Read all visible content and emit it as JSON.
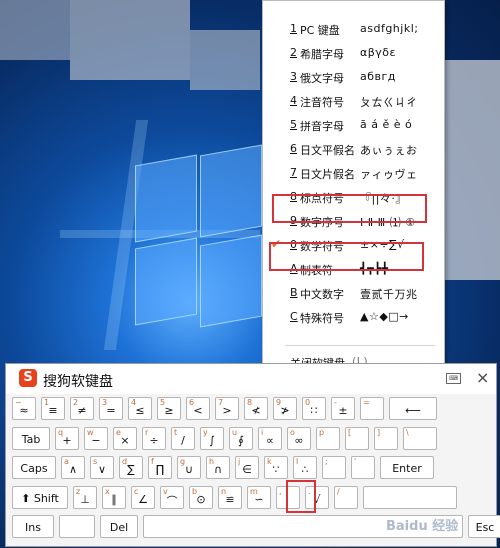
{
  "menu": {
    "items": [
      {
        "num": "1",
        "label": "PC 键盘",
        "sample": "asdfghjkl;",
        "checked": false
      },
      {
        "num": "2",
        "label": "希腊字母",
        "sample": "αβγδε",
        "checked": false
      },
      {
        "num": "3",
        "label": "俄文字母",
        "sample": "абвгд",
        "checked": false
      },
      {
        "num": "4",
        "label": "注音符号",
        "sample": "ㄆㄊㄍㄐㄔ",
        "checked": false
      },
      {
        "num": "5",
        "label": "拼音字母",
        "sample": "ā á ě è ó",
        "checked": false
      },
      {
        "num": "6",
        "label": "日文平假名",
        "sample": "あぃぅぇお",
        "checked": false
      },
      {
        "num": "7",
        "label": "日文片假名",
        "sample": "ァィゥヴェ",
        "checked": false
      },
      {
        "num": "8",
        "label": "标点符号",
        "sample": "『||々·』",
        "checked": false
      },
      {
        "num": "9",
        "label": "数字序号",
        "sample": "Ⅰ Ⅱ Ⅲ ⑴ ①",
        "checked": false
      },
      {
        "num": "0",
        "label": "数学符号",
        "sample": "±×÷∑√",
        "checked": true
      },
      {
        "num": "A",
        "label": "制表符",
        "sample": "┫┳┣╋",
        "checked": false
      },
      {
        "num": "B",
        "label": "中文数字",
        "sample": "壹贰千万兆",
        "checked": false
      },
      {
        "num": "C",
        "label": "特殊符号",
        "sample": "▲☆◆□→",
        "checked": false
      }
    ],
    "close_label": "关闭软键盘",
    "close_shortcut": "(L)"
  },
  "keyboard": {
    "title": "搜狗软键盘",
    "logo": "S",
    "close": "×",
    "rows": [
      [
        {
          "s": "~",
          "m": "≈",
          "w": 26
        },
        {
          "s": "1",
          "m": "≡",
          "w": 26
        },
        {
          "s": "2",
          "m": "≠",
          "w": 26
        },
        {
          "s": "3",
          "m": "=",
          "w": 26
        },
        {
          "s": "4",
          "m": "≤",
          "w": 26
        },
        {
          "s": "5",
          "m": "≥",
          "w": 26
        },
        {
          "s": "6",
          "m": "<",
          "w": 26
        },
        {
          "s": "7",
          "m": ">",
          "w": 26
        },
        {
          "s": "8",
          "m": "≮",
          "w": 26
        },
        {
          "s": "9",
          "m": "≯",
          "w": 26
        },
        {
          "s": "0",
          "m": "∷",
          "w": 26
        },
        {
          "s": "-",
          "m": "±",
          "w": 26
        },
        {
          "s": "=",
          "m": "",
          "w": 26
        },
        {
          "s": "",
          "m": "⟵",
          "w": 50
        }
      ],
      [
        {
          "s": "",
          "m": "Tab",
          "w": 40,
          "f": true
        },
        {
          "s": "q",
          "m": "+",
          "w": 26
        },
        {
          "s": "w",
          "m": "−",
          "w": 26
        },
        {
          "s": "e",
          "m": "×",
          "w": 26
        },
        {
          "s": "r",
          "m": "÷",
          "w": 26
        },
        {
          "s": "t",
          "m": "/",
          "w": 26
        },
        {
          "s": "y",
          "m": "∫",
          "w": 26
        },
        {
          "s": "u",
          "m": "∮",
          "w": 26
        },
        {
          "s": "i",
          "m": "∝",
          "w": 26
        },
        {
          "s": "o",
          "m": "∞",
          "w": 26
        },
        {
          "s": "p",
          "m": "",
          "w": 26
        },
        {
          "s": "[",
          "m": "",
          "w": 26
        },
        {
          "s": "]",
          "m": "",
          "w": 26
        },
        {
          "s": "\\",
          "m": "",
          "w": 36
        }
      ],
      [
        {
          "s": "",
          "m": "Caps",
          "w": 46,
          "f": true
        },
        {
          "s": "a",
          "m": "∧",
          "w": 26
        },
        {
          "s": "s",
          "m": "∨",
          "w": 26
        },
        {
          "s": "d",
          "m": "∑",
          "w": 26
        },
        {
          "s": "f",
          "m": "∏",
          "w": 26
        },
        {
          "s": "g",
          "m": "∪",
          "w": 26
        },
        {
          "s": "h",
          "m": "∩",
          "w": 26
        },
        {
          "s": "j",
          "m": "∈",
          "w": 26
        },
        {
          "s": "k",
          "m": "∵",
          "w": 26
        },
        {
          "s": "l",
          "m": "∴",
          "w": 26
        },
        {
          "s": ";",
          "m": "",
          "w": 26
        },
        {
          "s": "'",
          "m": "",
          "w": 26
        },
        {
          "s": "",
          "m": "Enter",
          "w": 56,
          "f": true
        }
      ],
      [
        {
          "s": "",
          "m": "⬆ Shift",
          "w": 58,
          "f": true
        },
        {
          "s": "z",
          "m": "⊥",
          "w": 26
        },
        {
          "s": "x",
          "m": "∥",
          "w": 26
        },
        {
          "s": "c",
          "m": "∠",
          "w": 26
        },
        {
          "s": "v",
          "m": "⌒",
          "w": 26
        },
        {
          "s": "b",
          "m": "⊙",
          "w": 26
        },
        {
          "s": "n",
          "m": "≌",
          "w": 26
        },
        {
          "s": "m",
          "m": "∽",
          "w": 26
        },
        {
          "s": ",",
          "m": "",
          "w": 26
        },
        {
          "s": ".",
          "m": "√",
          "w": 26
        },
        {
          "s": "/",
          "m": "",
          "w": 26
        },
        {
          "s": "",
          "m": "",
          "w": 96
        }
      ],
      [
        {
          "s": "",
          "m": "Ins",
          "w": 44,
          "f": true
        },
        {
          "s": "",
          "m": "",
          "w": 38
        },
        {
          "s": "",
          "m": "Del",
          "w": 40,
          "f": true
        },
        {
          "s": "",
          "m": "",
          "w": 322
        },
        {
          "s": "",
          "m": "Esc",
          "w": 36,
          "f": true
        }
      ]
    ]
  },
  "watermark": "Baidu 经验",
  "colors": {
    "accent": "#e8692d",
    "highlight": "#d3343a",
    "orange_hint": "#c0703a"
  }
}
